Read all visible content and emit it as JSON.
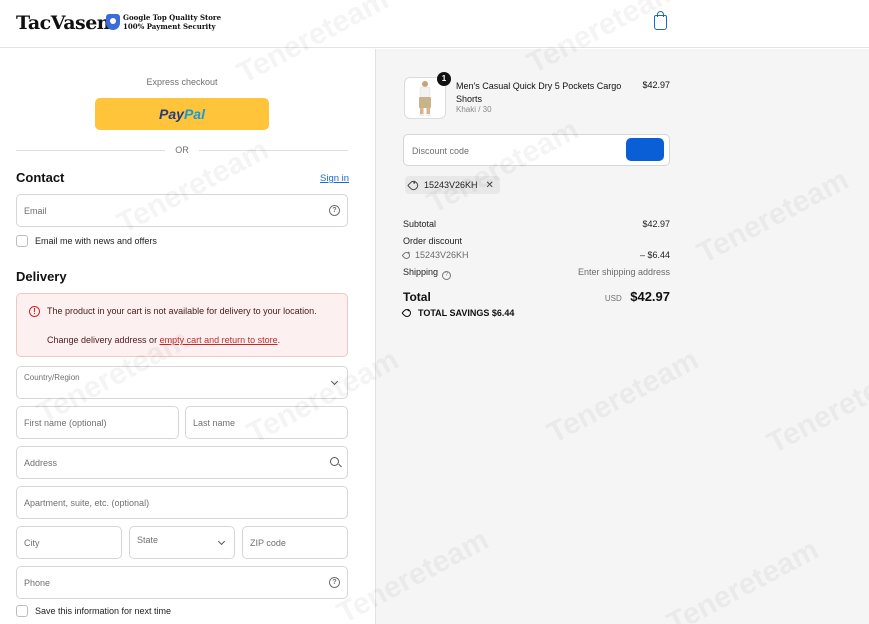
{
  "header": {
    "logo": "TacVasen",
    "trust_line1": "Google Top Quality Store",
    "trust_line2": "100% Payment Security"
  },
  "express": {
    "label": "Express checkout",
    "paypal_part1": "Pay",
    "paypal_part2": "Pal",
    "or": "OR"
  },
  "contact": {
    "title": "Contact",
    "sign_in": "Sign in",
    "email_placeholder": "Email",
    "newsletter_label": "Email me with news and offers"
  },
  "delivery": {
    "title": "Delivery",
    "alert_message": "The product in your cart is not available for delivery to your location.",
    "alert_prefix": "Change delivery address or ",
    "alert_link": "empty cart and return to store",
    "alert_suffix": ".",
    "country_label": "Country/Region",
    "first_name": "First name (optional)",
    "last_name": "Last name",
    "address": "Address",
    "apartment": "Apartment, suite, etc. (optional)",
    "city": "City",
    "state": "State",
    "zip": "ZIP code",
    "phone": "Phone",
    "save_info_label": "Save this information for next time"
  },
  "order": {
    "item": {
      "quantity": "1",
      "name": "Men's Casual Quick Dry 5 Pockets Cargo Shorts",
      "variant": "Khaki / 30",
      "price": "$42.97"
    },
    "discount_placeholder": "Discount code",
    "applied_code": "15243V26KH",
    "subtotal_label": "Subtotal",
    "subtotal_value": "$42.97",
    "order_discount_label": "Order discount",
    "discount_code": "15243V26KH",
    "discount_value": "– $6.44",
    "shipping_label": "Shipping",
    "shipping_value": "Enter shipping address",
    "total_label": "Total",
    "currency": "USD",
    "total_value": "$42.97",
    "savings_label": "TOTAL SAVINGS",
    "savings_value": "$6.44"
  },
  "watermark": "Tenereteam",
  "colors": {
    "accent": "#1a66d6",
    "paypal_yellow": "#ffc439",
    "apply_button": "#0a5fd7",
    "error": "#c42a2a"
  }
}
